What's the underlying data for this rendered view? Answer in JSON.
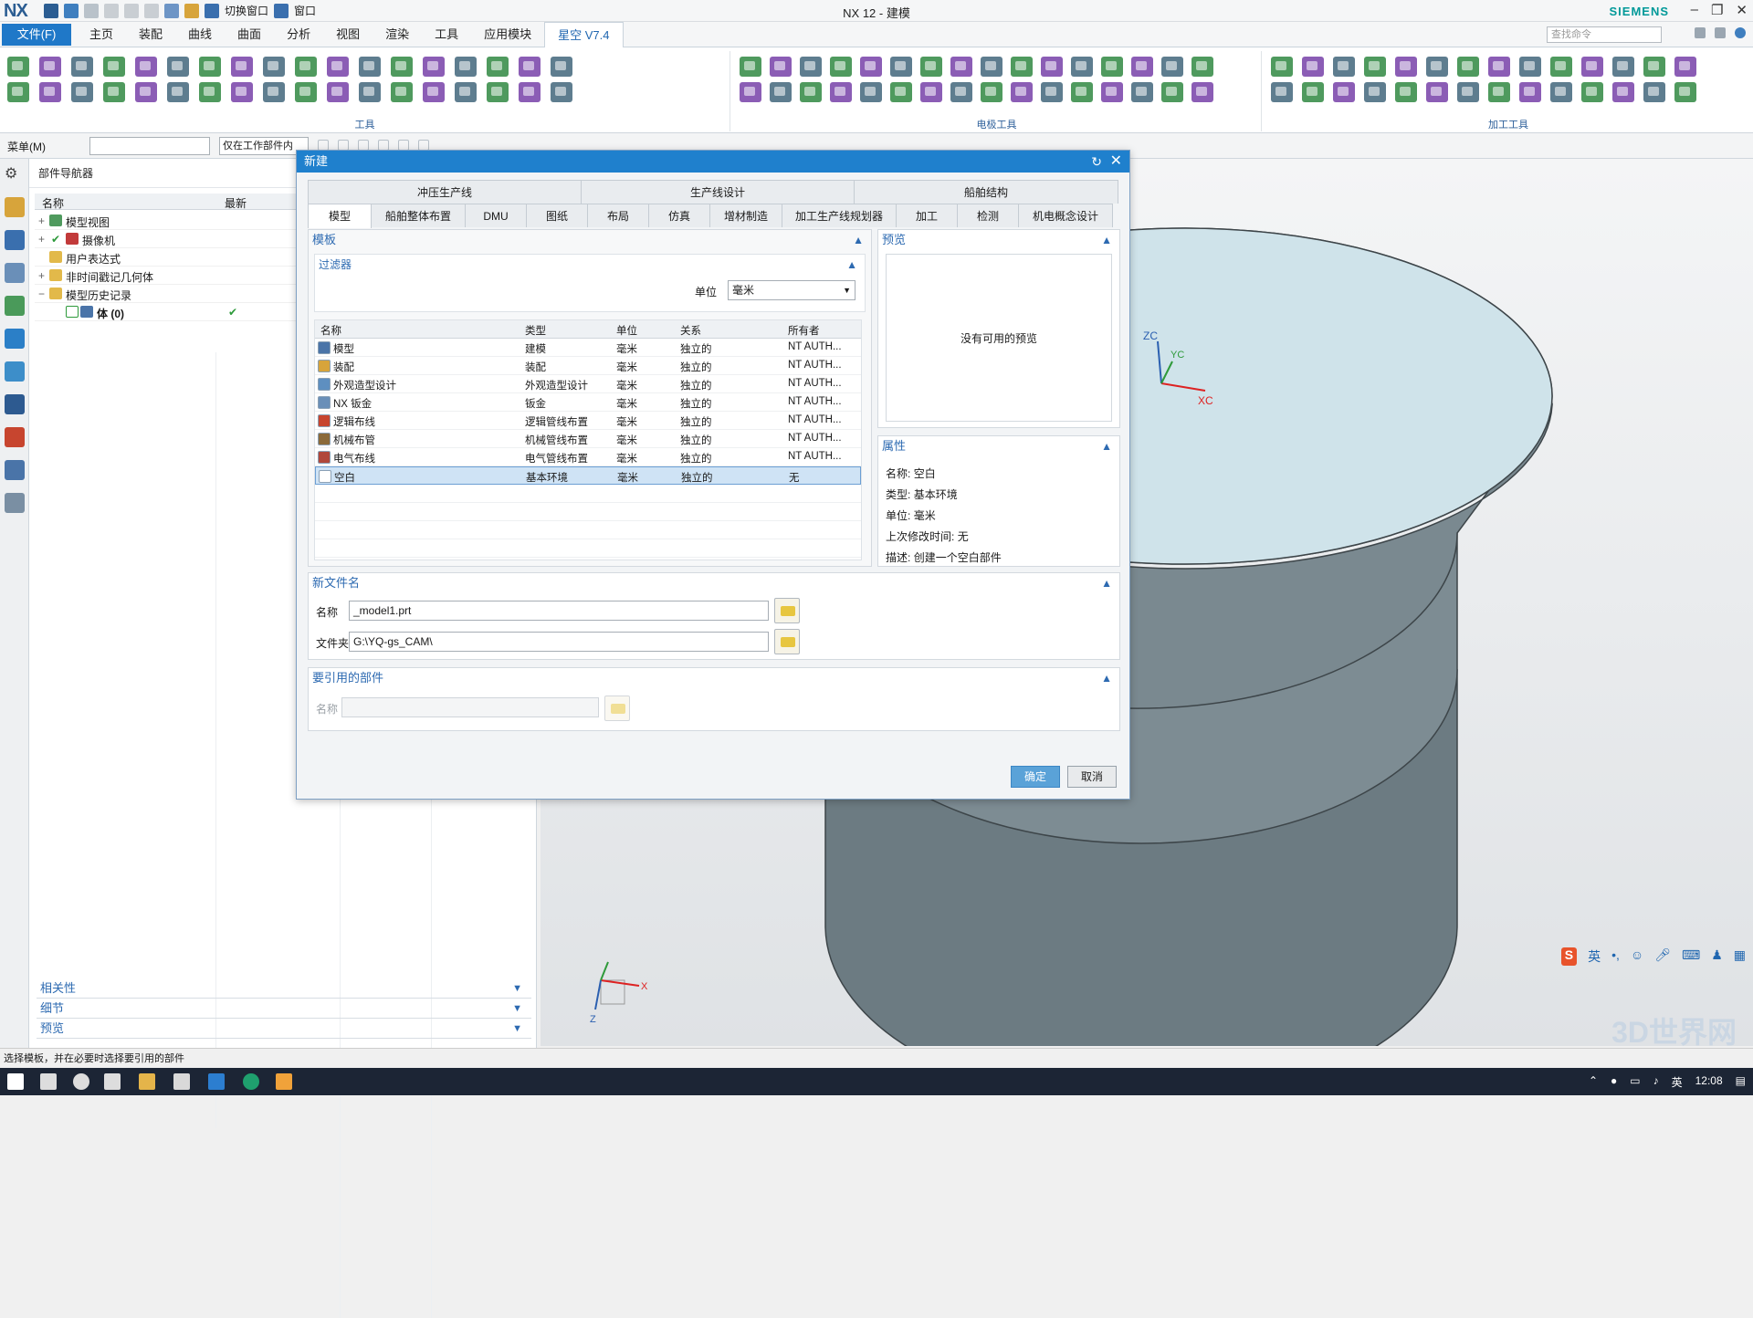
{
  "app": {
    "logo": "NX",
    "window_title": "NX 12 - 建模",
    "brand": "SIEMENS",
    "quick_switch": "切换窗口",
    "quick_window": "窗口"
  },
  "menubar": {
    "file": "文件(F)",
    "tabs": [
      "主页",
      "装配",
      "曲线",
      "曲面",
      "分析",
      "视图",
      "渲染",
      "工具",
      "应用模块",
      "星空 V7.4"
    ],
    "search_placeholder": "查找命令"
  },
  "ribbon": {
    "groups": [
      "工具",
      "电极工具",
      "加工工具"
    ]
  },
  "selection_bar": {
    "menu": "菜单(M)",
    "filter_scope": "仅在工作部件内"
  },
  "part_navigator": {
    "title": "部件导航器",
    "col_name": "名称",
    "col_latest": "最新",
    "items": [
      {
        "label": "模型视图"
      },
      {
        "label": "摄像机"
      },
      {
        "label": "用户表达式"
      },
      {
        "label": "非时间戳记几何体"
      },
      {
        "label": "模型历史记录"
      },
      {
        "label": "体 (0)"
      }
    ],
    "panels": [
      "相关性",
      "细节",
      "预览"
    ]
  },
  "viewport": {
    "axis_zc": "ZC",
    "axis_yc": "YC",
    "axis_xc": "XC",
    "small_x": "X",
    "small_z": "Z"
  },
  "status": {
    "message": "选择模板，并在必要时选择要引用的部件"
  },
  "taskbar": {
    "lang": "英",
    "time": "12:08",
    "ime_lang": "英"
  },
  "watermark": "3D世界网",
  "dialog": {
    "title": "新建",
    "tabs_top": [
      "冲压生产线",
      "生产线设计",
      "船舶结构"
    ],
    "tabs_bottom": [
      "模型",
      "船舶整体布置",
      "DMU",
      "图纸",
      "布局",
      "仿真",
      "增材制造",
      "加工生产线规划器",
      "加工",
      "检测",
      "机电概念设计"
    ],
    "template_section": "模板",
    "filter_section": "过滤器",
    "unit_label": "单位",
    "unit_value": "毫米",
    "table_headers": [
      "名称",
      "类型",
      "单位",
      "关系",
      "所有者"
    ],
    "templates": [
      {
        "name": "模型",
        "type": "建模",
        "unit": "毫米",
        "relation": "独立的",
        "owner": "NT AUTH..."
      },
      {
        "name": "装配",
        "type": "装配",
        "unit": "毫米",
        "relation": "独立的",
        "owner": "NT AUTH..."
      },
      {
        "name": "外观造型设计",
        "type": "外观造型设计",
        "unit": "毫米",
        "relation": "独立的",
        "owner": "NT AUTH..."
      },
      {
        "name": "NX 钣金",
        "type": "钣金",
        "unit": "毫米",
        "relation": "独立的",
        "owner": "NT AUTH..."
      },
      {
        "name": "逻辑布线",
        "type": "逻辑管线布置",
        "unit": "毫米",
        "relation": "独立的",
        "owner": "NT AUTH..."
      },
      {
        "name": "机械布管",
        "type": "机械管线布置",
        "unit": "毫米",
        "relation": "独立的",
        "owner": "NT AUTH..."
      },
      {
        "name": "电气布线",
        "type": "电气管线布置",
        "unit": "毫米",
        "relation": "独立的",
        "owner": "NT AUTH..."
      },
      {
        "name": "空白",
        "type": "基本环境",
        "unit": "毫米",
        "relation": "独立的",
        "owner": "无"
      }
    ],
    "preview_section": "预览",
    "preview_empty": "没有可用的预览",
    "properties_section": "属性",
    "props": {
      "name_label": "名称:",
      "name_value": "空白",
      "type_label": "类型:",
      "type_value": "基本环境",
      "unit_label": "单位:",
      "unit_value": "毫米",
      "modified_label": "上次修改时间:",
      "modified_value": "无",
      "desc_label": "描述:",
      "desc_value": "创建一个空白部件"
    },
    "newfile_section": "新文件名",
    "name_field_label": "名称",
    "name_field_value": "_model1.prt",
    "folder_field_label": "文件夹",
    "folder_field_value": "G:\\YQ-gs_CAM\\",
    "ref_section": "要引用的部件",
    "ref_name_label": "名称",
    "ok": "确定",
    "cancel": "取消"
  }
}
